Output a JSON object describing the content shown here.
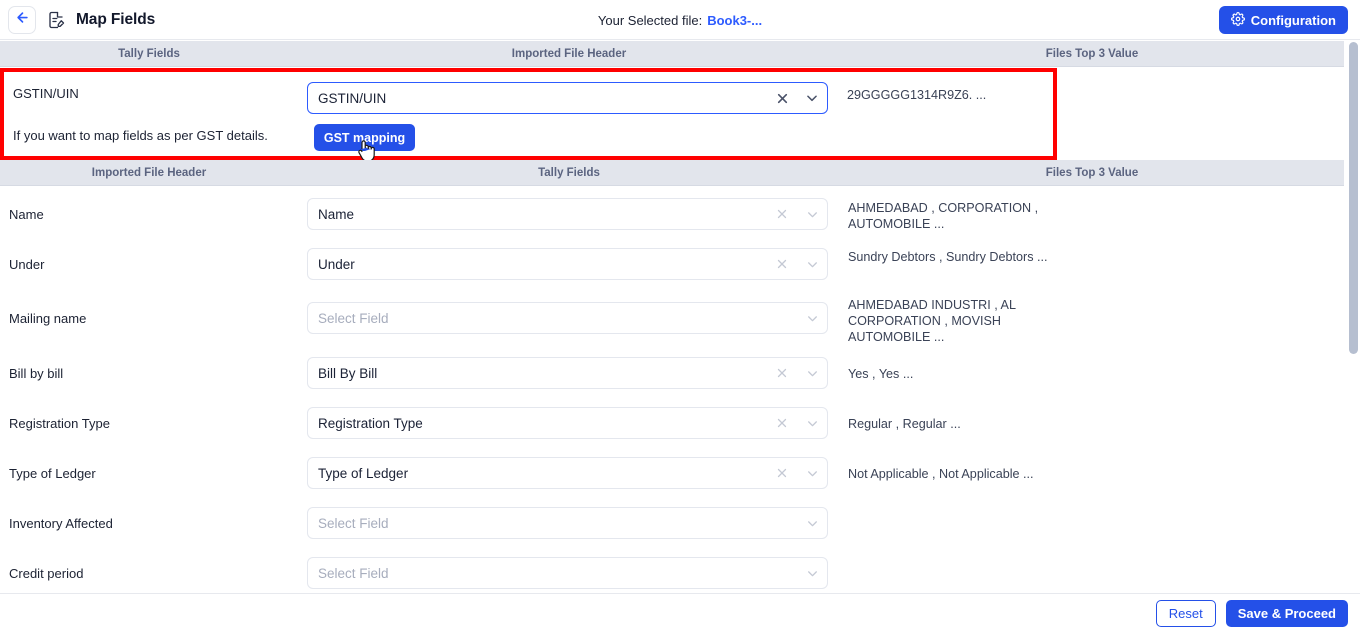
{
  "topbar": {
    "back_icon": "arrow-left-icon",
    "doc_icon": "document-edit-icon",
    "title": "Map Fields",
    "file_label": "Your Selected file:",
    "file_name": "Book3-...",
    "config_icon": "gear-icon",
    "config_label": "Configuration",
    "accent_color": "#2450e8",
    "link_color": "#2d5bff"
  },
  "header_strip_top": {
    "col1": "Tally Fields",
    "col2": "Imported File Header",
    "col3": "Files Top 3 Value"
  },
  "header_strip_mid": {
    "col1": "Imported File Header",
    "col2": "Tally Fields",
    "col3": "Files Top 3 Value"
  },
  "highlight": {
    "border_color": "#ff0000",
    "label": "GSTIN/UIN",
    "select_value": "GSTIN/UIN",
    "clear_icon": "close-icon",
    "chevron_icon": "chevron-down-icon",
    "top_values": "29GGGGG1314R9Z6. ...",
    "note": "If you want to map fields as per GST details.",
    "gst_button": "GST mapping",
    "cursor_icon": "pointing-hand-cursor"
  },
  "placeholder": "Select Field",
  "rows": [
    {
      "label": "Name",
      "value": "Name",
      "empty": false,
      "top_values": "AHMEDABAD , CORPORATION , AUTOMOBILE ..."
    },
    {
      "label": "Under",
      "value": "Under",
      "empty": false,
      "top_values": "Sundry Debtors , Sundry Debtors ..."
    },
    {
      "label": "Mailing name",
      "value": "Select Field",
      "empty": true,
      "top_values": "AHMEDABAD INDUSTRI , AL CORPORATION , MOVISH AUTOMOBILE ..."
    },
    {
      "label": "Bill by bill",
      "value": "Bill By Bill",
      "empty": false,
      "top_values": "Yes , Yes ..."
    },
    {
      "label": "Registration Type",
      "value": "Registration Type",
      "empty": false,
      "top_values": "Regular , Regular ..."
    },
    {
      "label": "Type of Ledger",
      "value": "Type of Ledger",
      "empty": false,
      "top_values": "Not Applicable , Not Applicable ..."
    },
    {
      "label": "Inventory Affected",
      "value": "Select Field",
      "empty": true,
      "top_values": ""
    },
    {
      "label": "Credit period",
      "value": "Select Field",
      "empty": true,
      "top_values": ""
    }
  ],
  "footer": {
    "reset_label": "Reset",
    "save_label": "Save & Proceed"
  }
}
